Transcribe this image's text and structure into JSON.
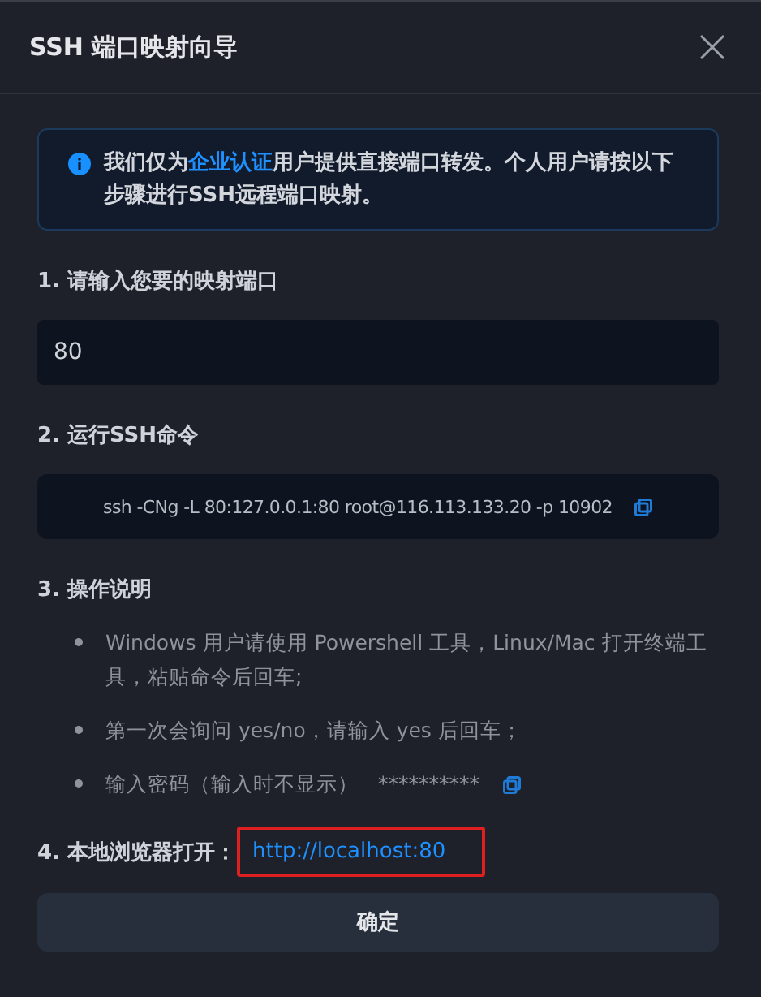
{
  "dialog": {
    "title": "SSH 端口映射向导",
    "notice": {
      "before": "我们仅为",
      "link": "企业认证",
      "after": "用户提供直接端口转发。个人用户请按以下步骤进行SSH远程端口映射。"
    },
    "steps": [
      {
        "kind": "input",
        "title": "1. 请输入您要的映射端口",
        "value": "80"
      },
      {
        "kind": "command",
        "title": "2. 运行SSH命令",
        "command": "ssh -CNg -L 80:127.0.0.1:80 root@116.113.133.20 -p 10902"
      },
      {
        "kind": "list",
        "title": "3. 操作说明",
        "items": [
          {
            "text": "Windows 用户请使用 Powershell 工具，Linux/Mac 打开终端工具，粘贴命令后回车;"
          },
          {
            "text": "第一次会询问 yes/no，请输入 yes 后回车；"
          },
          {
            "text": "输入密码（输入时不显示）",
            "secret": "**********"
          }
        ]
      },
      {
        "kind": "link",
        "title": "4. 本地浏览器打开：",
        "url": "http://localhost:80",
        "highlighted": true
      }
    ],
    "confirm_button": "确定"
  }
}
